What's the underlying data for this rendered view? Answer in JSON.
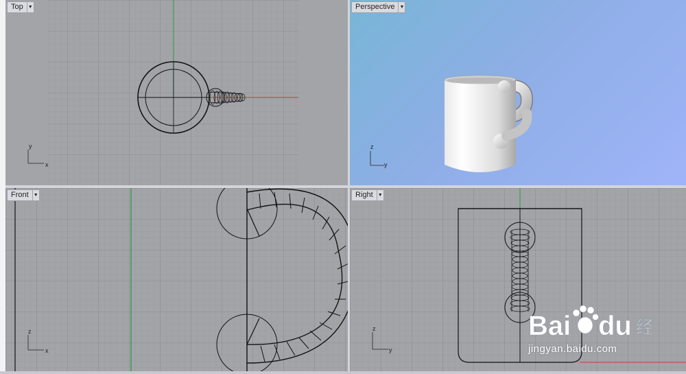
{
  "viewports": {
    "top": {
      "label": "Top",
      "axis_x": "x",
      "axis_y": "y"
    },
    "perspective": {
      "label": "Perspective",
      "axis_z": "z",
      "axis_y": "y"
    },
    "front": {
      "label": "Front",
      "axis_x": "x",
      "axis_z": "z"
    },
    "right": {
      "label": "Right",
      "axis_y": "y",
      "axis_z": "z"
    }
  },
  "watermark": {
    "brand": "Bai",
    "brand_end": "du",
    "product": "经验",
    "url": "jingyan.baidu.com"
  },
  "colors": {
    "viewport_bg": "#a2a4a8",
    "grid_minor": "#979a9f",
    "grid_major": "#85888d",
    "axis_x": "#c83a3a",
    "axis_y": "#2f9a3a",
    "wire": "#111111"
  },
  "icons": {
    "dropdown": "chevron-down-icon"
  }
}
